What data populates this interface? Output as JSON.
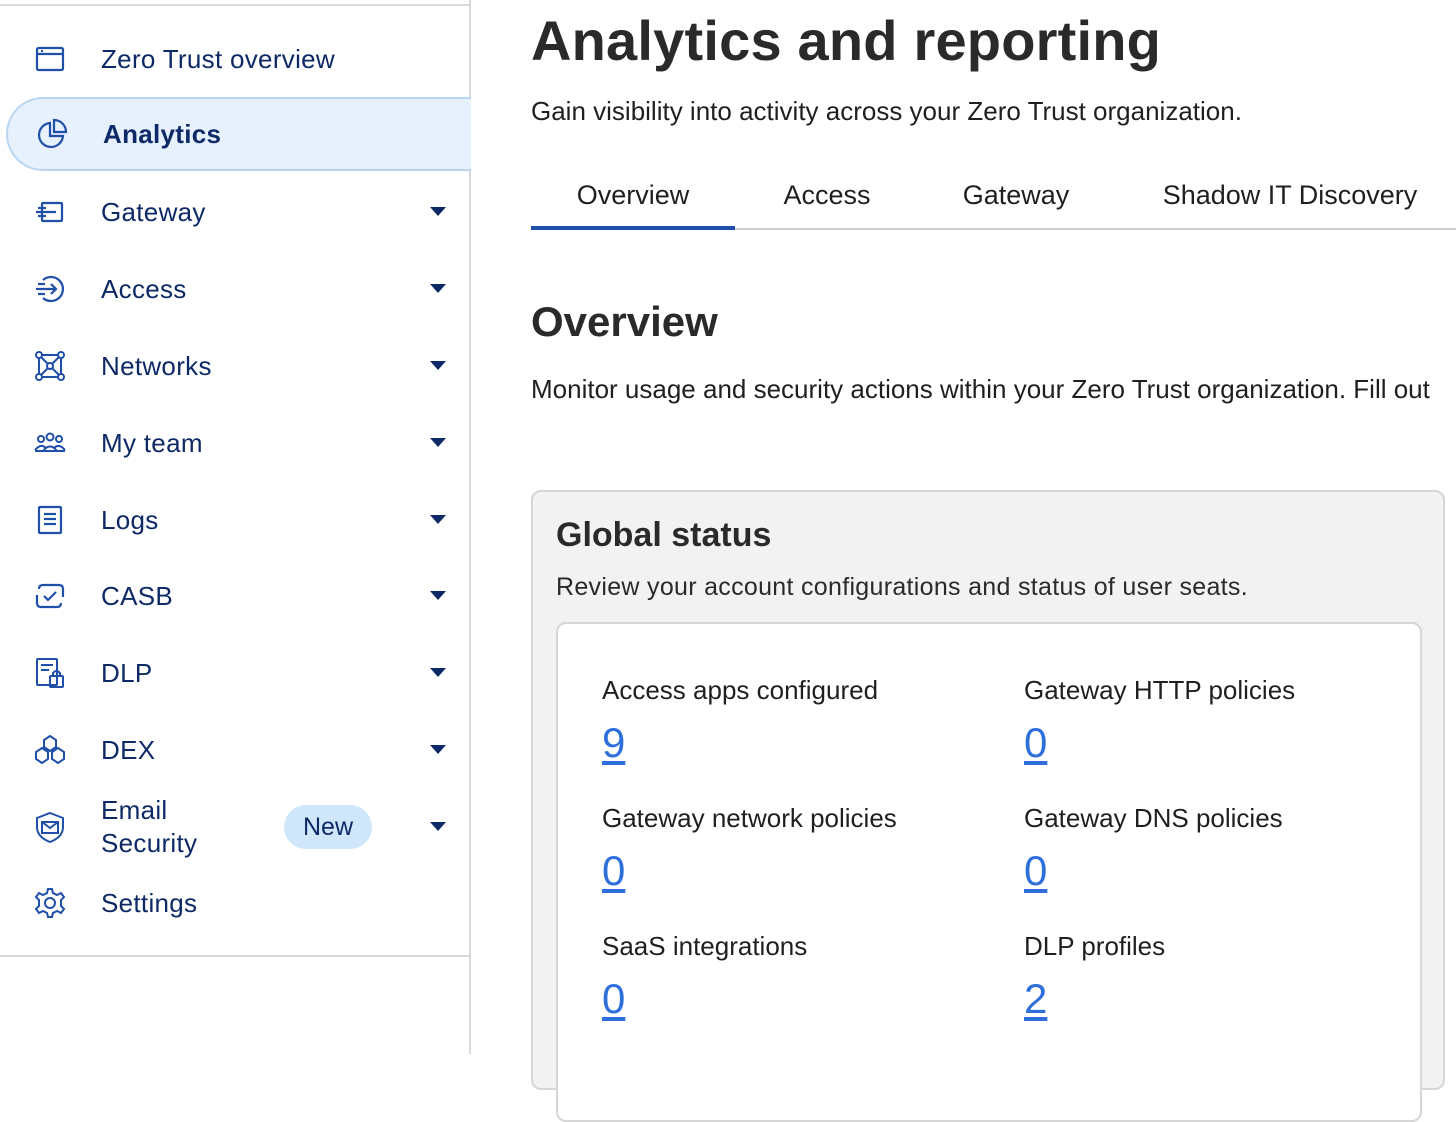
{
  "sidebar": {
    "items": [
      {
        "label": "Zero Trust overview",
        "icon": "browser-window-icon",
        "has_caret": false
      },
      {
        "label": "Analytics",
        "icon": "pie-chart-icon",
        "has_caret": false,
        "active": true
      },
      {
        "label": "Gateway",
        "icon": "gateway-icon",
        "has_caret": true
      },
      {
        "label": "Access",
        "icon": "access-icon",
        "has_caret": true
      },
      {
        "label": "Networks",
        "icon": "network-icon",
        "has_caret": true
      },
      {
        "label": "My team",
        "icon": "team-icon",
        "has_caret": true
      },
      {
        "label": "Logs",
        "icon": "logs-icon",
        "has_caret": true
      },
      {
        "label": "CASB",
        "icon": "casb-icon",
        "has_caret": true
      },
      {
        "label": "DLP",
        "icon": "dlp-icon",
        "has_caret": true
      },
      {
        "label": "DEX",
        "icon": "dex-icon",
        "has_caret": true
      },
      {
        "label": "Email Security",
        "icon": "email-security-icon",
        "has_caret": true,
        "badge": "New"
      },
      {
        "label": "Settings",
        "icon": "gear-icon",
        "has_caret": false
      }
    ]
  },
  "header": {
    "title": "Analytics and reporting",
    "subtitle": "Gain visibility into activity across your Zero Trust organization."
  },
  "tabs": [
    {
      "label": "Overview",
      "active": true
    },
    {
      "label": "Access"
    },
    {
      "label": "Gateway"
    },
    {
      "label": "Shadow IT Discovery"
    }
  ],
  "overview": {
    "title": "Overview",
    "description": "Monitor usage and security actions within your Zero Trust organization. Fill out"
  },
  "global_status": {
    "title": "Global status",
    "description": "Review your account configurations and status of user seats.",
    "stats": [
      {
        "label": "Access apps configured",
        "value": "9"
      },
      {
        "label": "Gateway HTTP policies",
        "value": "0"
      },
      {
        "label": "Gateway network policies",
        "value": "0"
      },
      {
        "label": "Gateway DNS policies",
        "value": "0"
      },
      {
        "label": "SaaS integrations",
        "value": "0"
      },
      {
        "label": "DLP profiles",
        "value": "2"
      }
    ]
  },
  "colors": {
    "nav_text": "#0e2a66",
    "active_bg": "#e6f1fd",
    "tab_accent": "#1f4fa8",
    "link": "#2f6fdc",
    "badge_bg": "#cfe6fb"
  }
}
